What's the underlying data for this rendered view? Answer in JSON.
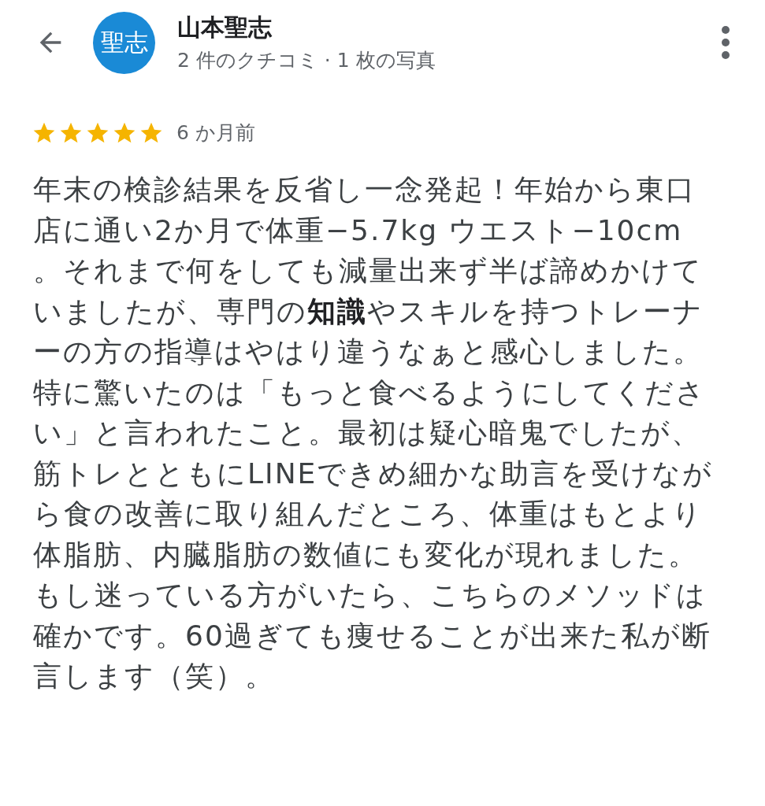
{
  "header": {
    "avatar_text": "聖志",
    "name": "山本聖志",
    "meta": "2 件のクチコミ · 1 枚の写真"
  },
  "review": {
    "stars": 5,
    "time": "6 か月前",
    "text": "年末の検診結果を反省し一念発起！年始から東口店に通い2か月で体重−5.7kg ウエスト−10cm 。それまで何をしても減量出来ず半ば諦めかけていましたが、専門の**知識**やスキルを持つトレーナーの方の指導はやはり違うなぁと感心しました。特に驚いたのは「もっと食べるようにしてください」と言われたこと。最初は疑心暗鬼でしたが、筋トレとともにLINEできめ細かな助言を受けながら食の改善に取り組んだところ、体重はもとより体脂肪、内臓脂肪の数値にも変化が現れました。もし迷っている方がいたら、こちらのメソッドは確かです。60過ぎても痩せることが出来た私が断言します（笑）。"
  }
}
